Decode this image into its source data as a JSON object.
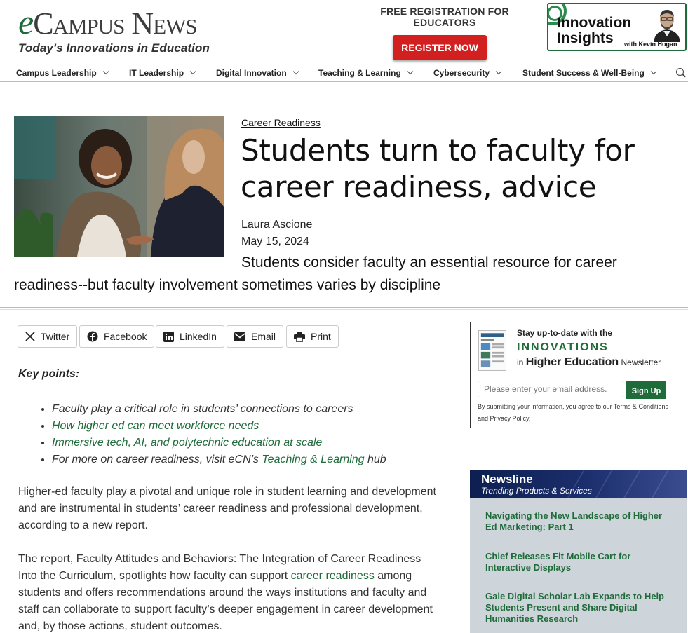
{
  "header": {
    "logo_e": "e",
    "logo_campus": "Campus",
    "logo_news": "News",
    "tagline": "Today's Innovations in Education",
    "registration_text": "FREE REGISTRATION FOR EDUCATORS",
    "register_button": "REGISTER NOW",
    "promo_title_1": "Innovation",
    "promo_title_2": "Insights",
    "promo_with": "with Kevin Hogan"
  },
  "nav": {
    "items": [
      {
        "label": "Campus Leadership"
      },
      {
        "label": "IT Leadership"
      },
      {
        "label": "Digital Innovation"
      },
      {
        "label": "Teaching & Learning"
      },
      {
        "label": "Cybersecurity"
      },
      {
        "label": "Student Success & Well-Being"
      }
    ]
  },
  "article": {
    "category": "Career Readiness",
    "title": "Students turn to faculty for career readiness, advice",
    "author": "Laura Ascione",
    "date": "May 15, 2024",
    "subtitle": "Students consider faculty an essential resource for career readiness--but faculty involvement sometimes varies by discipline",
    "key_points_label": "Key points:",
    "key_points": {
      "p1": "Faculty play a critical role in students’ connections to careers",
      "p2": "How higher ed can meet workforce needs",
      "p3": "Immersive tech, AI, and polytechnic education at scale",
      "p4_pre": "For more on career readiness, visit eCN’s ",
      "p4_link": "Teaching & Learning",
      "p4_post": " hub"
    },
    "para1": "Higher-ed faculty play a pivotal and unique role in student learning and development and are instrumental in students’ career readiness and professional development, according to a new report.",
    "para2_pre": "The report, Faculty Attitudes and Behaviors: The Integration of Career Readiness Into the Curriculum, spotlights how faculty can support ",
    "para2_link": "career readiness",
    "para2_post": " among students and offers recommendations around the ways institutions and faculty and staff can collaborate to support faculty’s deeper engagement in career development and, by those actions, student outcomes."
  },
  "share": {
    "twitter": "Twitter",
    "facebook": "Facebook",
    "linkedin": "LinkedIn",
    "email": "Email",
    "print": "Print"
  },
  "newsletter": {
    "line1": "Stay up-to-date with the",
    "line2": "INNOVATIONS",
    "line3_pre": "in ",
    "line3_bold": "Higher Education",
    "line3_post": " Newsletter",
    "placeholder": "Please enter your email address.",
    "button": "Sign Up",
    "fine_print": "By submitting your information, you agree to our Terms & Conditions and Privacy Policy."
  },
  "newsline": {
    "title": "Newsline",
    "subtitle": "Trending Products & Services",
    "stories": [
      {
        "title": "Navigating the New Landscape of Higher Ed Marketing: Part 1"
      },
      {
        "title": "Chief Releases Fit Mobile Cart for Interactive Displays"
      },
      {
        "title": "Gale Digital Scholar Lab Expands to Help Students Present and Share Digital Humanities Research"
      }
    ]
  },
  "colors": {
    "brand_green": "#1f6b3a",
    "register_red": "#d21f1f",
    "newsline_navy": "#0d1f4f",
    "newsline_bg": "#cdd5da"
  }
}
